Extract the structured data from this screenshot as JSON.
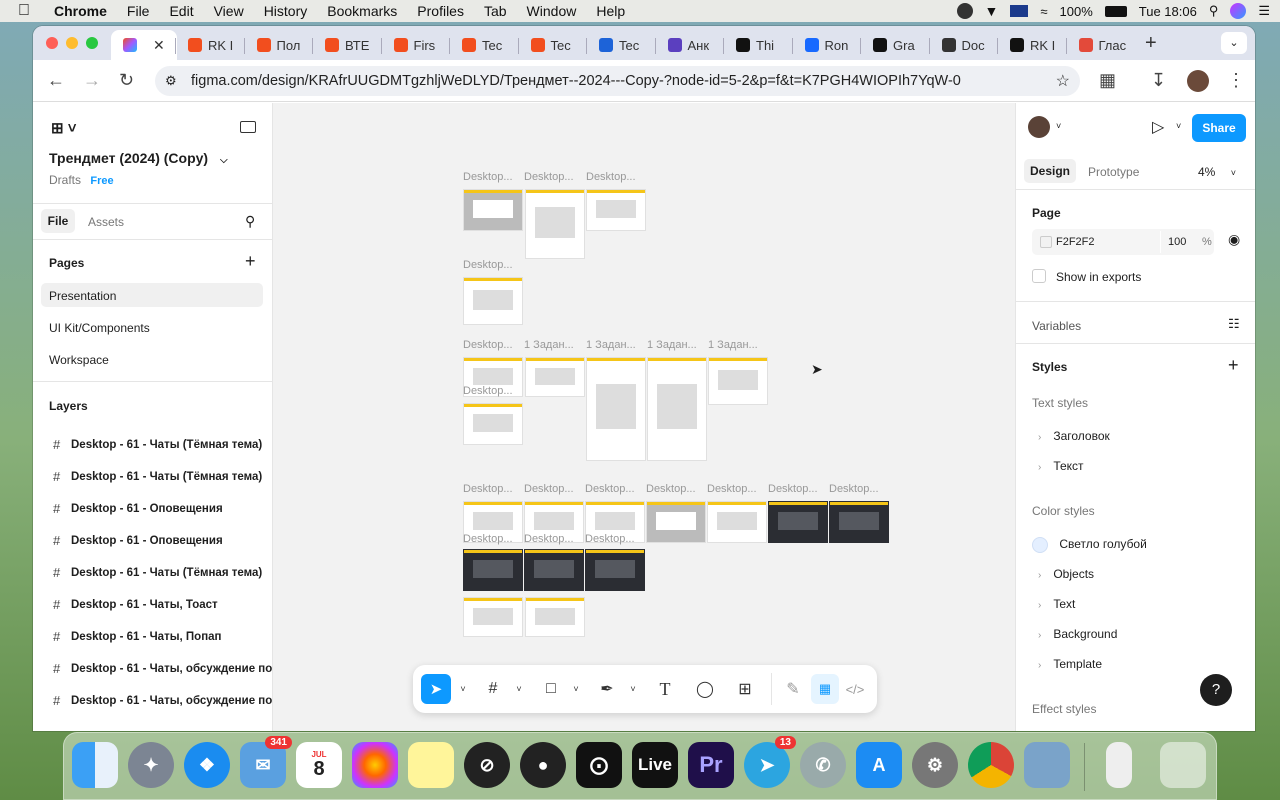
{
  "menubar": {
    "app": "Chrome",
    "items": [
      "File",
      "Edit",
      "View",
      "History",
      "Bookmarks",
      "Profiles",
      "Tab",
      "Window",
      "Help"
    ],
    "battery": "100%",
    "clock": "Tue 18:06"
  },
  "tabs": [
    {
      "label": ""
    },
    {
      "label": "RK I"
    },
    {
      "label": "Пол"
    },
    {
      "label": "ВТЕ"
    },
    {
      "label": "Firs"
    },
    {
      "label": "Tec"
    },
    {
      "label": "Tec"
    },
    {
      "label": "Tec"
    },
    {
      "label": "Анк"
    },
    {
      "label": "Thi"
    },
    {
      "label": "Ron"
    },
    {
      "label": "Gra"
    },
    {
      "label": "Doc"
    },
    {
      "label": "RK I"
    },
    {
      "label": "Глас"
    }
  ],
  "url": "figma.com/design/KRAfrUUGDMTgzhljWeDLYD/Трендмет--2024---Copy-?node-id=5-2&p=f&t=K7PGH4WIOPIh7YqW-0",
  "left": {
    "file_name": "Трендмет (2024) (Copy)",
    "drafts": "Drafts",
    "plan": "Free",
    "tab_file": "File",
    "tab_assets": "Assets",
    "pages_title": "Pages",
    "pages": [
      "Presentation",
      "UI Kit/Components",
      "Workspace"
    ],
    "layers_title": "Layers",
    "layers": [
      "Desktop - 61 - Чаты (Тёмная тема)",
      "Desktop - 61 - Чаты (Тёмная тема)",
      "Desktop - 61 - Оповещения",
      "Desktop - 61 - Оповещения",
      "Desktop - 61 - Чаты (Тёмная тема)",
      "Desktop - 61 - Чаты, Тоаст",
      "Desktop - 61 - Чаты, Попап",
      "Desktop - 61 - Чаты, обсуждение по",
      "Desktop - 61 - Чаты, обсуждение по"
    ]
  },
  "canvas": {
    "desktop": "Desktop...",
    "task": "1 Задан..."
  },
  "right": {
    "tab_design": "Design",
    "tab_prototype": "Prototype",
    "zoom": "4%",
    "share": "Share",
    "page_title": "Page",
    "page_color": "F2F2F2",
    "page_opacity": "100",
    "percent": "%",
    "show_exports": "Show in exports",
    "variables": "Variables",
    "styles": "Styles",
    "text_styles": "Text styles",
    "text_items": [
      "Заголовок",
      "Текст"
    ],
    "color_styles": "Color styles",
    "color_swatch": "Светло голубой",
    "color_items": [
      "Objects",
      "Text",
      "Background",
      "Template"
    ],
    "effect_styles": "Effect styles",
    "help": "?"
  },
  "dock": {
    "mail_badge": "341",
    "cal_month": "JUL",
    "cal_day": "8",
    "live": "Live",
    "pr": "Pr",
    "tg_badge": "13"
  }
}
